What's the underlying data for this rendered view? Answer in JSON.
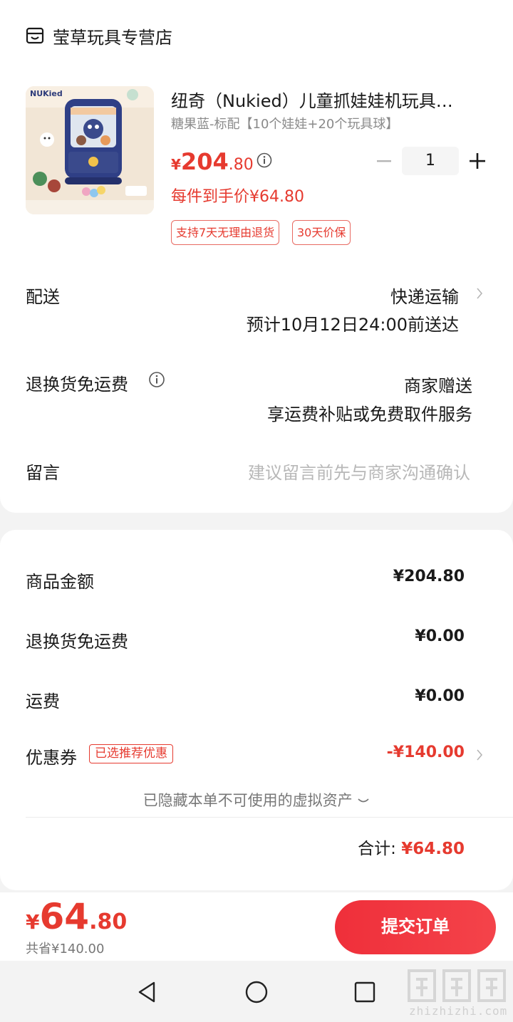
{
  "store": {
    "name": "莹草玩具专营店"
  },
  "product": {
    "title": "纽奇（Nukied）儿童抓娃娃机玩具…",
    "spec": "糖果蓝-标配【10个娃娃+20个玩具球】",
    "price_currency": "¥",
    "price_int": "204",
    "price_dec": ".80",
    "unit_price": "每件到手价¥64.80",
    "tags": [
      "支持7天无理由退货",
      "30天价保"
    ],
    "quantity": "1",
    "image_brand": "NUKied"
  },
  "delivery": {
    "label": "配送",
    "method": "快递运输",
    "eta": "预计10月12日24:00前送达"
  },
  "return_shipping": {
    "label": "退换货免运费",
    "value": "商家赠送",
    "detail": "享运费补贴或免费取件服务"
  },
  "message": {
    "label": "留言",
    "placeholder": "建议留言前先与商家沟通确认"
  },
  "summary": {
    "goods_label": "商品金额",
    "goods_value": "¥204.80",
    "return_label": "退换货免运费",
    "return_value": "¥0.00",
    "shipping_label": "运费",
    "shipping_value": "¥0.00",
    "coupon_label": "优惠券",
    "coupon_tag": "已选推荐优惠",
    "coupon_value": "-¥140.00",
    "hidden_assets": "已隐藏本单不可使用的虚拟资产",
    "total_label": "合计: ",
    "total_value": "¥64.80"
  },
  "footer": {
    "currency": "¥",
    "int": "64",
    "dec": ".80",
    "savings": "共省¥140.00",
    "submit": "提交订单"
  },
  "watermark": {
    "text": "zhizhizhi.com"
  },
  "colors": {
    "accent": "#e63a2f",
    "button": "#f03a42",
    "muted": "#8a8a8a"
  }
}
